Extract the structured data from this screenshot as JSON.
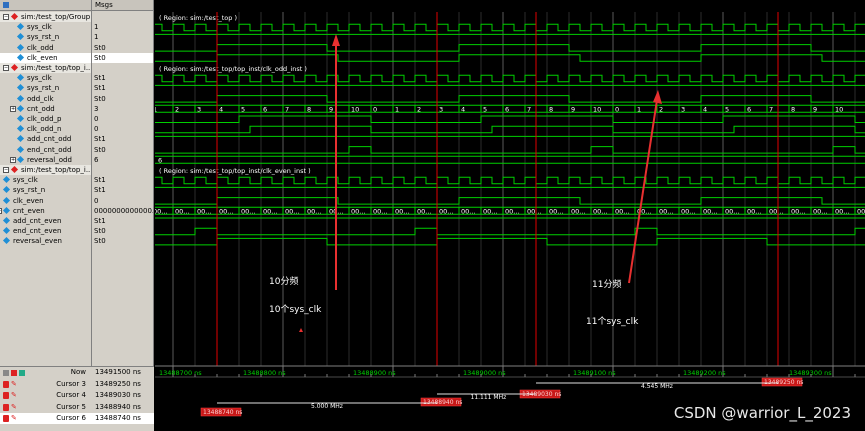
{
  "header": {
    "msgs_label": "Msgs"
  },
  "signals": [
    {
      "name": "sim:/test_top/Group1",
      "value": "",
      "kind": "group",
      "indent": 0
    },
    {
      "name": "sys_clk",
      "value": "1",
      "kind": "wire",
      "indent": 1
    },
    {
      "name": "sys_rst_n",
      "value": "1",
      "kind": "wire",
      "indent": 1
    },
    {
      "name": "clk_odd",
      "value": "St0",
      "kind": "wire",
      "indent": 1
    },
    {
      "name": "clk_even",
      "value": "St0",
      "kind": "wire",
      "indent": 1,
      "selected": true
    },
    {
      "name": "sim:/test_top/top_i...",
      "value": "",
      "kind": "group",
      "indent": 0
    },
    {
      "name": "sys_clk",
      "value": "St1",
      "kind": "wire",
      "indent": 1
    },
    {
      "name": "sys_rst_n",
      "value": "St1",
      "kind": "wire",
      "indent": 1
    },
    {
      "name": "odd_clk",
      "value": "St0",
      "kind": "wire",
      "indent": 1
    },
    {
      "name": "cnt_odd",
      "value": "3",
      "kind": "bus",
      "indent": 1
    },
    {
      "name": "clk_odd_p",
      "value": "0",
      "kind": "wire",
      "indent": 1
    },
    {
      "name": "clk_odd_n",
      "value": "0",
      "kind": "wire",
      "indent": 1
    },
    {
      "name": "add_cnt_odd",
      "value": "St1",
      "kind": "wire",
      "indent": 1
    },
    {
      "name": "end_cnt_odd",
      "value": "St0",
      "kind": "wire",
      "indent": 1
    },
    {
      "name": "reversal_odd",
      "value": "6",
      "kind": "bus",
      "indent": 1
    },
    {
      "name": "sim:/test_top/top_i...",
      "value": "",
      "kind": "group",
      "indent": 0
    },
    {
      "name": "sys_clk",
      "value": "St1",
      "kind": "wire",
      "indent": 0
    },
    {
      "name": "sys_rst_n",
      "value": "St1",
      "kind": "wire",
      "indent": 0
    },
    {
      "name": "clk_even",
      "value": "0",
      "kind": "wire",
      "indent": 0
    },
    {
      "name": "cnt_even",
      "value": "0000000000000...",
      "kind": "bus",
      "indent": 0
    },
    {
      "name": "add_cnt_even",
      "value": "St1",
      "kind": "wire",
      "indent": 0
    },
    {
      "name": "end_cnt_even",
      "value": "St0",
      "kind": "wire",
      "indent": 0
    },
    {
      "name": "reversal_even",
      "value": "St0",
      "kind": "wire",
      "indent": 0
    }
  ],
  "regions": [
    {
      "label": "( Region: sim:/test_top )"
    },
    {
      "label": "( Region: sim:/test_top/top_inst/clk_odd_inst )"
    },
    {
      "label": "( Region: sim:/test_top/top_inst/clk_even_inst )"
    }
  ],
  "bus_labels": {
    "cnt_odd": [
      "0",
      "1",
      "2",
      "3",
      "4",
      "5",
      "6",
      "7",
      "8",
      "9",
      "10",
      "0",
      "1",
      "2",
      "3",
      "4",
      "5",
      "6",
      "7",
      "8",
      "9",
      "10",
      "0",
      "1",
      "2",
      "3",
      "4",
      "5",
      "6",
      "7",
      "8",
      "9",
      "10"
    ],
    "reversal_odd": "6",
    "cnt_even": "00..."
  },
  "cursor_pane": {
    "now_label": "Now",
    "now_value": "13491500 ns",
    "cursors": [
      {
        "label": "Cursor 3",
        "value": "13489250 ns"
      },
      {
        "label": "Cursor 4",
        "value": "13489030 ns"
      },
      {
        "label": "Cursor 5",
        "value": "13488940 ns"
      },
      {
        "label": "Cursor 6",
        "value": "13488740 ns",
        "selected": true
      }
    ],
    "timeline": [
      "13488700 ns",
      "13488800 ns",
      "13488900 ns",
      "13489000 ns",
      "13489100 ns",
      "13489200 ns",
      "13489300 ns"
    ],
    "cursor_tags": [
      "13489250 ns",
      "13489030 ns",
      "13488940 ns",
      "13488740 ns"
    ],
    "freq_labels": [
      "4.545 MHz",
      "11.111 MHz",
      "5.000 MHz"
    ]
  },
  "annotations": {
    "odd_div": "10分频",
    "odd_clk_count": "10个sys_clk",
    "even_div": "11分频",
    "even_clk_count": "11个sys_clk"
  },
  "watermark": "CSDN @warrior_L_2023",
  "colors": {
    "wave": "#00d000",
    "cursor": "#e00000",
    "bus_text": "#ffffff",
    "region_text": "#ffffff",
    "grid": "#303030"
  }
}
